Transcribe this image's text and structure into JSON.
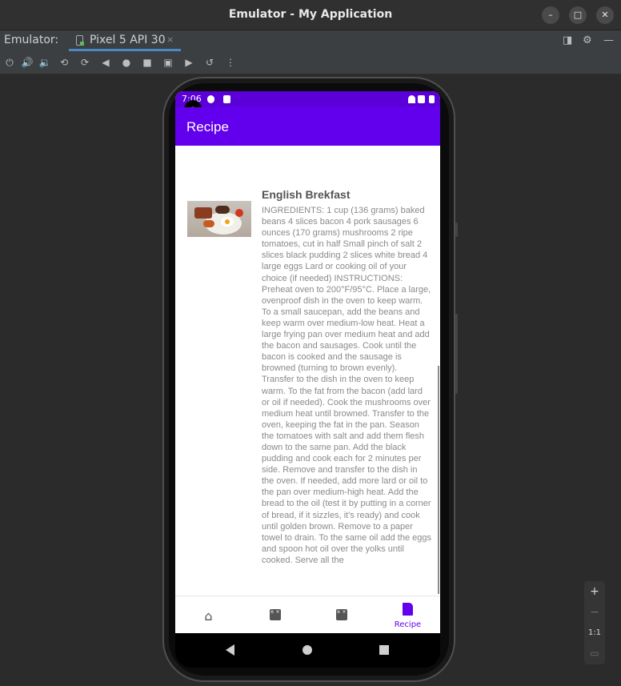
{
  "window": {
    "title": "Emulator - My Application",
    "controls": [
      "minimize",
      "maximize",
      "close"
    ]
  },
  "tabbar": {
    "label": "Emulator:",
    "tab": {
      "name": "Pixel 5 API 30",
      "close": "×"
    }
  },
  "toolbar": {
    "icons": [
      "power-icon",
      "volume-up-icon",
      "volume-down-icon",
      "rotate-left-icon",
      "rotate-right-icon",
      "back-icon",
      "home-icon",
      "overview-icon",
      "screenshot-icon",
      "record-icon",
      "reset-icon",
      "more-icon"
    ]
  },
  "phone": {
    "status": {
      "time": "7:06"
    },
    "app_title": "Recipe",
    "recipe": {
      "title": "English Brekfast",
      "body": "INGREDIENTS: 1 cup (136 grams) baked beans 4 slices bacon 4 pork sausages 6 ounces (170 grams) mushrooms 2 ripe tomatoes, cut in half Small pinch of salt 2 slices black pudding 2 slices white bread 4 large eggs Lard or cooking oil of your choice (if needed) INSTRUCTIONS: Preheat oven to 200°F/95°C. Place a large, ovenproof dish in the oven to keep warm. To a small saucepan, add the beans and keep warm over medium-low heat. Heat a large frying pan over medium heat and add the bacon and sausages. Cook until the bacon is cooked and the sausage is browned (turning to brown evenly). Transfer to the dish in the oven to keep warm. To the fat from the bacon (add lard or oil if needed). Cook the mushrooms over medium heat until browned. Transfer to the oven, keeping the fat in the pan. Season the tomatoes with salt and add them flesh down to the same pan. Add the black pudding and cook each for 2 minutes per side. Remove and transfer to the dish in the oven. If needed, add more lard or oil to the pan over medium-high heat. Add the bread to the oil (test it by putting in a corner of bread, if it sizzles, it's ready) and cook until golden brown. Remove to a paper towel to drain. To the same oil add the eggs and spoon hot oil over the yolks until cooked. Serve all the"
    },
    "bottom_nav": [
      {
        "icon": "home-icon",
        "label": ""
      },
      {
        "icon": "calculator-icon",
        "label": ""
      },
      {
        "icon": "calculator-icon",
        "label": ""
      },
      {
        "icon": "document-icon",
        "label": "Recipe",
        "active": true
      }
    ]
  },
  "zoom": {
    "plus": "+",
    "minus": "−",
    "ratio": "1:1"
  },
  "colors": {
    "primary": "#6200ee",
    "status_bar": "#5b00d9",
    "ide_bg": "#2b2b2b"
  }
}
